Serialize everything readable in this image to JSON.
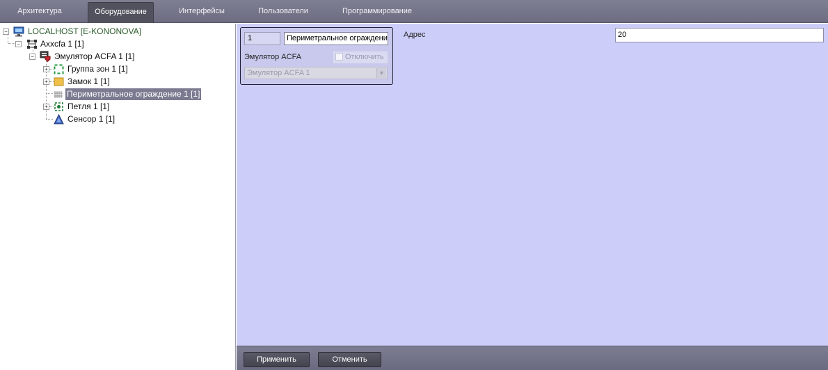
{
  "tabs": [
    {
      "label": "Архитектура",
      "active": false
    },
    {
      "label": "Оборудование",
      "active": true
    },
    {
      "label": "Интерфейсы",
      "active": false
    },
    {
      "label": "Пользователи",
      "active": false
    },
    {
      "label": "Программирование",
      "active": false
    }
  ],
  "tree": {
    "root": "LOCALHOST [E-KONONOVA]",
    "axxon": "Axxcfa 1 [1]",
    "emulator": "Эмулятор ACFA 1 [1]",
    "items": [
      {
        "label": "Группа зон 1 [1]",
        "icon": "zone-group-icon"
      },
      {
        "label": "Замок 1 [1]",
        "icon": "lock-icon"
      },
      {
        "label": "Периметральное ограждение 1 [1]",
        "icon": "perimeter-fence-icon",
        "selected": true
      },
      {
        "label": "Петля 1 [1]",
        "icon": "loop-icon"
      },
      {
        "label": "Сенсор 1 [1]",
        "icon": "sensor-icon"
      }
    ]
  },
  "object": {
    "id": "1",
    "name": "Периметральное ограждение",
    "type_label": "Эмулятор ACFA",
    "disable_label": "Отключить",
    "parent_value": "Эмулятор ACFA 1"
  },
  "settings": {
    "address_label": "Адрес",
    "address_value": "20"
  },
  "buttons": {
    "apply": "Применить",
    "cancel": "Отменить"
  },
  "colors": {
    "panel_bg": "#cdcdf9",
    "tab_bar": "#7f7f93",
    "selection": "#7a7a90",
    "root_text": "#2b5d2b"
  }
}
